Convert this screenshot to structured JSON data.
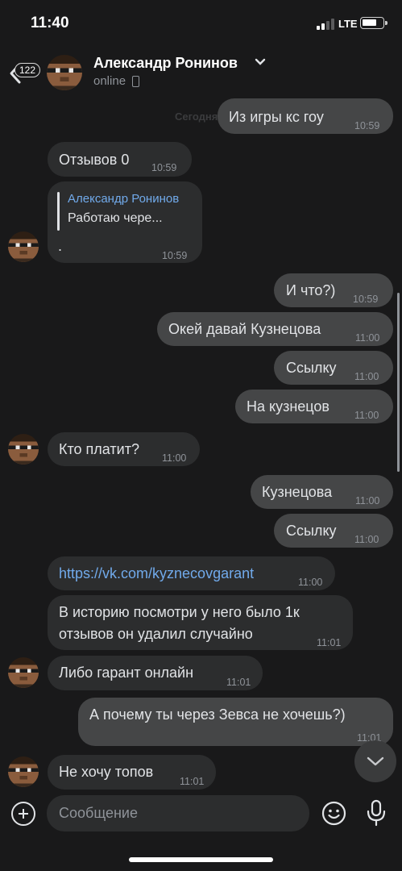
{
  "status_bar": {
    "time": "11:40",
    "network": "LTE"
  },
  "header": {
    "back_count": "122",
    "contact_name": "Александр Ронинов",
    "status": "online"
  },
  "date_separator": "Сегодня",
  "messages": [
    {
      "dir": "out",
      "text": "Из игры кс гоу",
      "time": "10:59"
    },
    {
      "dir": "in",
      "text": "Отзывов 0",
      "time": "10:59"
    },
    {
      "dir": "in",
      "reply_author": "Александр Ронинов",
      "reply_text": "Работаю чере...",
      "text": ".",
      "time": "10:59"
    },
    {
      "dir": "out",
      "text": "И что?)",
      "time": "10:59"
    },
    {
      "dir": "out",
      "text": "Окей давай Кузнецова",
      "time": "11:00"
    },
    {
      "dir": "out",
      "text": "Ссылку",
      "time": "11:00"
    },
    {
      "dir": "out",
      "text": "На кузнецов",
      "time": "11:00"
    },
    {
      "dir": "in",
      "text": "Кто платит?",
      "time": "11:00"
    },
    {
      "dir": "out",
      "text": "Кузнецова",
      "time": "11:00"
    },
    {
      "dir": "out",
      "text": "Ссылку",
      "time": "11:00"
    },
    {
      "dir": "in",
      "text": "https://vk.com/kyznecovgarant",
      "time": "11:00"
    },
    {
      "dir": "in",
      "text_line1": "В историю посмотри у него было 1к",
      "text_line2": "отзывов он удалил случайно",
      "time": "11:01"
    },
    {
      "dir": "in",
      "text": "Либо гарант онлайн",
      "time": "11:01"
    },
    {
      "dir": "out",
      "text": "А почему ты через Зевса не хочешь?)",
      "time": "11:01"
    },
    {
      "dir": "in",
      "text": "Не хочу топов",
      "time": "11:01"
    }
  ],
  "composer": {
    "placeholder": "Сообщение"
  },
  "colors": {
    "background": "#19191a",
    "incoming": "#2c2d2e",
    "outgoing": "#454647",
    "link": "#71aaeb"
  },
  "icons": [
    "back-arrow-icon",
    "chevron-down-icon",
    "phone-icon",
    "add-icon",
    "emoji-icon",
    "microphone-icon",
    "chevron-down-icon"
  ]
}
